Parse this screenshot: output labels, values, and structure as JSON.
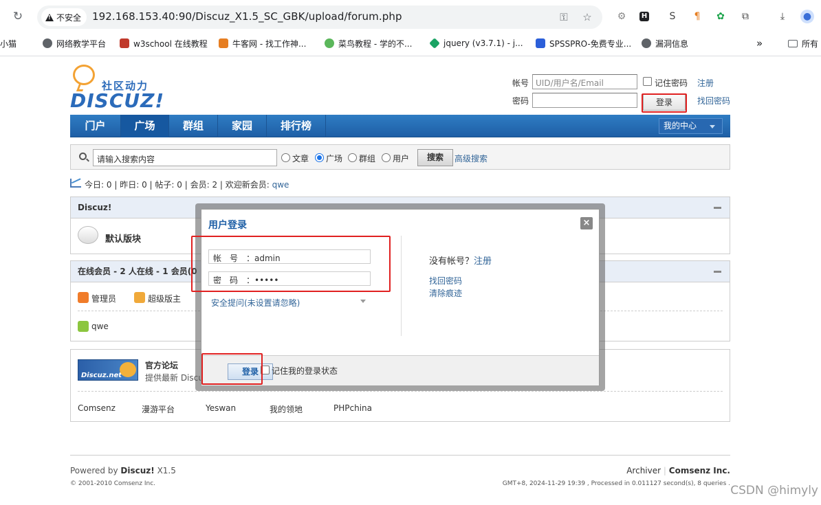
{
  "browser": {
    "security_label": "不安全",
    "url": "192.168.153.40:90/Discuz_X1.5_SC_GBK/upload/forum.php",
    "bookmarks": [
      {
        "label": "小猫",
        "color": "#ffffff"
      },
      {
        "label": "网络教学平台",
        "color": "#5f6368"
      },
      {
        "label": "w3school 在线教程",
        "color": "#c0392b"
      },
      {
        "label": "牛客网 - 找工作神...",
        "color": "#e67e22"
      },
      {
        "label": "菜鸟教程 - 学的不...",
        "color": "#5bb75b"
      },
      {
        "label": "jquery (v3.7.1) - j...",
        "color": "#1aa364"
      },
      {
        "label": "SPSSPRO-免费专业...",
        "color": "#2b5fd9"
      },
      {
        "label": "漏洞信息",
        "color": "#5f6368"
      }
    ],
    "more_bookmarks": "»",
    "all_bookmarks": "所有"
  },
  "site": {
    "logo_cn": "社区动力",
    "logo_en": "DISCUZ!"
  },
  "login_bar": {
    "account_label": "帐号",
    "account_placeholder": "UID/用户名/Email",
    "remember_label": "记住密码",
    "register_link": "注册",
    "password_label": "密码",
    "login_button": "登录",
    "forgot_link": "找回密码"
  },
  "nav": {
    "items": [
      "门户",
      "广场",
      "群组",
      "家园",
      "排行榜"
    ],
    "active": "广场",
    "my_center": "我的中心"
  },
  "search": {
    "placeholder": "请输入搜索内容",
    "options": [
      "文章",
      "广场",
      "群组",
      "用户"
    ],
    "selected": "广场",
    "button": "搜索",
    "advanced": "高级搜索"
  },
  "stats": {
    "today_label": "今日:",
    "today": "0",
    "yesterday_label": "昨日:",
    "yesterday": "0",
    "posts_label": "帖子:",
    "posts": "0",
    "members_label": "会员:",
    "members": "2",
    "welcome": "欢迎新会员:",
    "new_member": "qwe"
  },
  "forum_box": {
    "title": "Discuz!",
    "forum_name": "默认版块"
  },
  "online_box": {
    "title": "在线会员 - 2 人在线 - 1 会员(0",
    "legend": [
      {
        "label": "管理员",
        "color": "#f07c2a"
      },
      {
        "label": "超级版主",
        "color": "#f0a93a"
      }
    ],
    "members": [
      {
        "name": "qwe",
        "color": "#8cc63f"
      }
    ]
  },
  "links_box": {
    "site_title": "官方论坛",
    "site_desc": "提供最新 Discu",
    "banner_text": "Discuz.net",
    "links": [
      "Comsenz",
      "漫游平台",
      "Yeswan",
      "我的领地",
      "PHPchina"
    ]
  },
  "footer": {
    "powered_prefix": "Powered by",
    "powered_name": "Discuz!",
    "version": "X1.5",
    "copyright": "© 2001-2010 Comsenz Inc.",
    "archiver": "Archiver",
    "sep": "|",
    "company": "Comsenz Inc.",
    "meta": "GMT+8, 2024-11-29 19:39 , Processed in 0.011127 second(s), 8 queries .",
    "watermark": "CSDN @himyly"
  },
  "dialog": {
    "title": "用户登录",
    "close": "×",
    "account_label": "帐　号　：",
    "account_value": "admin",
    "password_label": "密　码　：",
    "password_value": "•••••",
    "security_question": "安全提问(未设置请忽略)",
    "no_account": "没有帐号？",
    "register": "注册",
    "forgot": "找回密码",
    "clear": "清除痕迹",
    "login_button": "登录",
    "remember": "记住我的登录状态"
  }
}
